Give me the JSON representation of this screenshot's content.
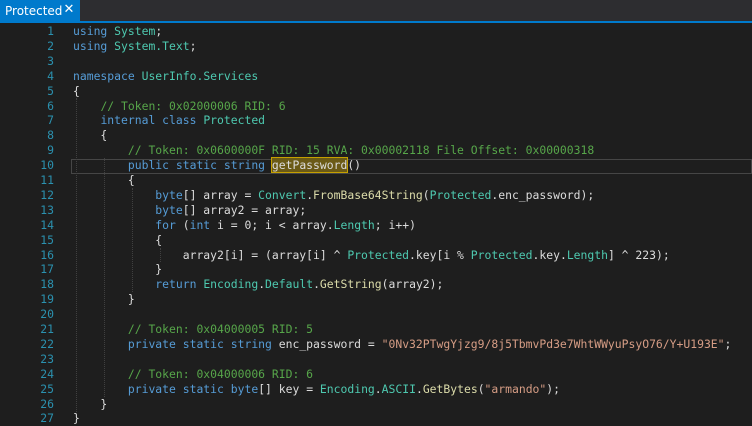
{
  "tab": {
    "title": "Protected",
    "close_icon": "close-icon"
  },
  "code_lines": [
    {
      "n": "1",
      "t": [
        [
          "kw",
          "using"
        ],
        [
          "p",
          " "
        ],
        [
          "ty",
          "System"
        ],
        [
          "p",
          ";"
        ]
      ]
    },
    {
      "n": "2",
      "t": [
        [
          "kw",
          "using"
        ],
        [
          "p",
          " "
        ],
        [
          "ty",
          "System.Text"
        ],
        [
          "p",
          ";"
        ]
      ]
    },
    {
      "n": "3",
      "t": []
    },
    {
      "n": "4",
      "t": [
        [
          "kw",
          "namespace"
        ],
        [
          "p",
          " "
        ],
        [
          "ty",
          "UserInfo.Services"
        ]
      ]
    },
    {
      "n": "5",
      "t": [
        [
          "p",
          "{"
        ]
      ]
    },
    {
      "n": "6",
      "t": [
        [
          "p",
          "    "
        ],
        [
          "cm",
          "// Token: 0x02000006 RID: 6"
        ]
      ]
    },
    {
      "n": "7",
      "t": [
        [
          "p",
          "    "
        ],
        [
          "kw",
          "internal class"
        ],
        [
          "p",
          " "
        ],
        [
          "ty",
          "Protected"
        ]
      ]
    },
    {
      "n": "8",
      "t": [
        [
          "p",
          "    {"
        ]
      ]
    },
    {
      "n": "9",
      "t": [
        [
          "p",
          "        "
        ],
        [
          "cm",
          "// Token: 0x0600000F RID: 15 RVA: 0x00002118 File Offset: 0x00000318"
        ]
      ]
    },
    {
      "n": "10",
      "t": [
        [
          "p",
          "        "
        ],
        [
          "kw",
          "public static string"
        ],
        [
          "p",
          " "
        ],
        [
          "hl",
          "getPassword"
        ],
        [
          "p",
          "()"
        ]
      ]
    },
    {
      "n": "11",
      "t": [
        [
          "p",
          "        {"
        ]
      ]
    },
    {
      "n": "12",
      "t": [
        [
          "p",
          "            "
        ],
        [
          "kw",
          "byte"
        ],
        [
          "p",
          "[] array = "
        ],
        [
          "ty",
          "Convert"
        ],
        [
          "p",
          "."
        ],
        [
          "mt",
          "FromBase64String"
        ],
        [
          "p",
          "("
        ],
        [
          "ty",
          "Protected"
        ],
        [
          "p",
          ".enc_password);"
        ]
      ]
    },
    {
      "n": "13",
      "t": [
        [
          "p",
          "            "
        ],
        [
          "kw",
          "byte"
        ],
        [
          "p",
          "[] array2 = array;"
        ]
      ]
    },
    {
      "n": "14",
      "t": [
        [
          "p",
          "            "
        ],
        [
          "kw",
          "for"
        ],
        [
          "p",
          " ("
        ],
        [
          "kw",
          "int"
        ],
        [
          "p",
          " i = 0; i < array."
        ],
        [
          "ty",
          "Length"
        ],
        [
          "p",
          "; i++)"
        ]
      ]
    },
    {
      "n": "15",
      "t": [
        [
          "p",
          "            {"
        ]
      ]
    },
    {
      "n": "16",
      "t": [
        [
          "p",
          "                array2[i] = (array[i] ^ "
        ],
        [
          "ty",
          "Protected"
        ],
        [
          "p",
          ".key[i % "
        ],
        [
          "ty",
          "Protected"
        ],
        [
          "p",
          ".key."
        ],
        [
          "ty",
          "Length"
        ],
        [
          "p",
          "] ^ 223);"
        ]
      ]
    },
    {
      "n": "17",
      "t": [
        [
          "p",
          "            }"
        ]
      ]
    },
    {
      "n": "18",
      "t": [
        [
          "p",
          "            "
        ],
        [
          "kw",
          "return"
        ],
        [
          "p",
          " "
        ],
        [
          "ty",
          "Encoding"
        ],
        [
          "p",
          "."
        ],
        [
          "ty",
          "Default"
        ],
        [
          "p",
          "."
        ],
        [
          "mt",
          "GetString"
        ],
        [
          "p",
          "(array2);"
        ]
      ]
    },
    {
      "n": "19",
      "t": [
        [
          "p",
          "        }"
        ]
      ]
    },
    {
      "n": "20",
      "t": []
    },
    {
      "n": "21",
      "t": [
        [
          "p",
          "        "
        ],
        [
          "cm",
          "// Token: 0x04000005 RID: 5"
        ]
      ]
    },
    {
      "n": "22",
      "t": [
        [
          "p",
          "        "
        ],
        [
          "kw",
          "private static string"
        ],
        [
          "p",
          " enc_password = "
        ],
        [
          "st",
          "\"0Nv32PTwgYjzg9/8j5TbmvPd3e7WhtWWyuPsyO76/Y+U193E\""
        ],
        [
          "p",
          ";"
        ]
      ]
    },
    {
      "n": "23",
      "t": []
    },
    {
      "n": "24",
      "t": [
        [
          "p",
          "        "
        ],
        [
          "cm",
          "// Token: 0x04000006 RID: 6"
        ]
      ]
    },
    {
      "n": "25",
      "t": [
        [
          "p",
          "        "
        ],
        [
          "kw",
          "private static byte"
        ],
        [
          "p",
          "[] key = "
        ],
        [
          "ty",
          "Encoding"
        ],
        [
          "p",
          "."
        ],
        [
          "ty",
          "ASCII"
        ],
        [
          "p",
          "."
        ],
        [
          "mt",
          "GetBytes"
        ],
        [
          "p",
          "("
        ],
        [
          "st",
          "\"armando\""
        ],
        [
          "p",
          ");"
        ]
      ]
    },
    {
      "n": "26",
      "t": [
        [
          "p",
          "    }"
        ]
      ]
    },
    {
      "n": "27",
      "t": [
        [
          "p",
          "}"
        ]
      ]
    }
  ],
  "colors": {
    "keyword": "#569cd6",
    "type": "#4ec9b0",
    "method": "#dcdcaa",
    "comment": "#57a64a",
    "string": "#d69d85",
    "plain": "#dcdcdc",
    "line_number": "#2b91af",
    "tab_active": "#007acc"
  }
}
